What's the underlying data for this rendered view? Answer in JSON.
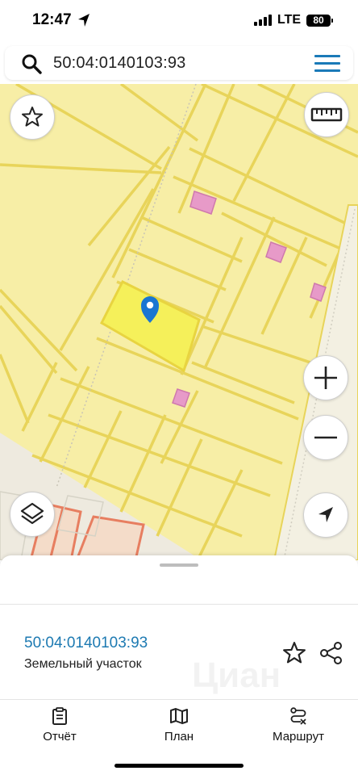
{
  "status_bar": {
    "time": "12:47",
    "network": "LTE",
    "battery": "80"
  },
  "search": {
    "query": "50:04:0140103:93",
    "icon": "search-icon",
    "menu_icon": "hamburger-menu-icon"
  },
  "map": {
    "parcel_color": "#f5f05a",
    "land_color": "#f7eea6",
    "boundary_color": "#e8cf5a",
    "building_color": "#e79ac8",
    "marker_color": "#1a76d2",
    "controls": [
      "star-icon",
      "ruler-icon",
      "zoom-in-icon",
      "zoom-out-icon",
      "location-arrow-icon",
      "layers-icon"
    ]
  },
  "sheet": {
    "parcel_number": "50:04:0140103:93",
    "parcel_type": "Земельный участок",
    "watermark": "Циан"
  },
  "tabs": [
    {
      "label": "Отчёт",
      "icon": "report-icon"
    },
    {
      "label": "План",
      "icon": "map-plan-icon"
    },
    {
      "label": "Маршрут",
      "icon": "route-icon"
    }
  ]
}
